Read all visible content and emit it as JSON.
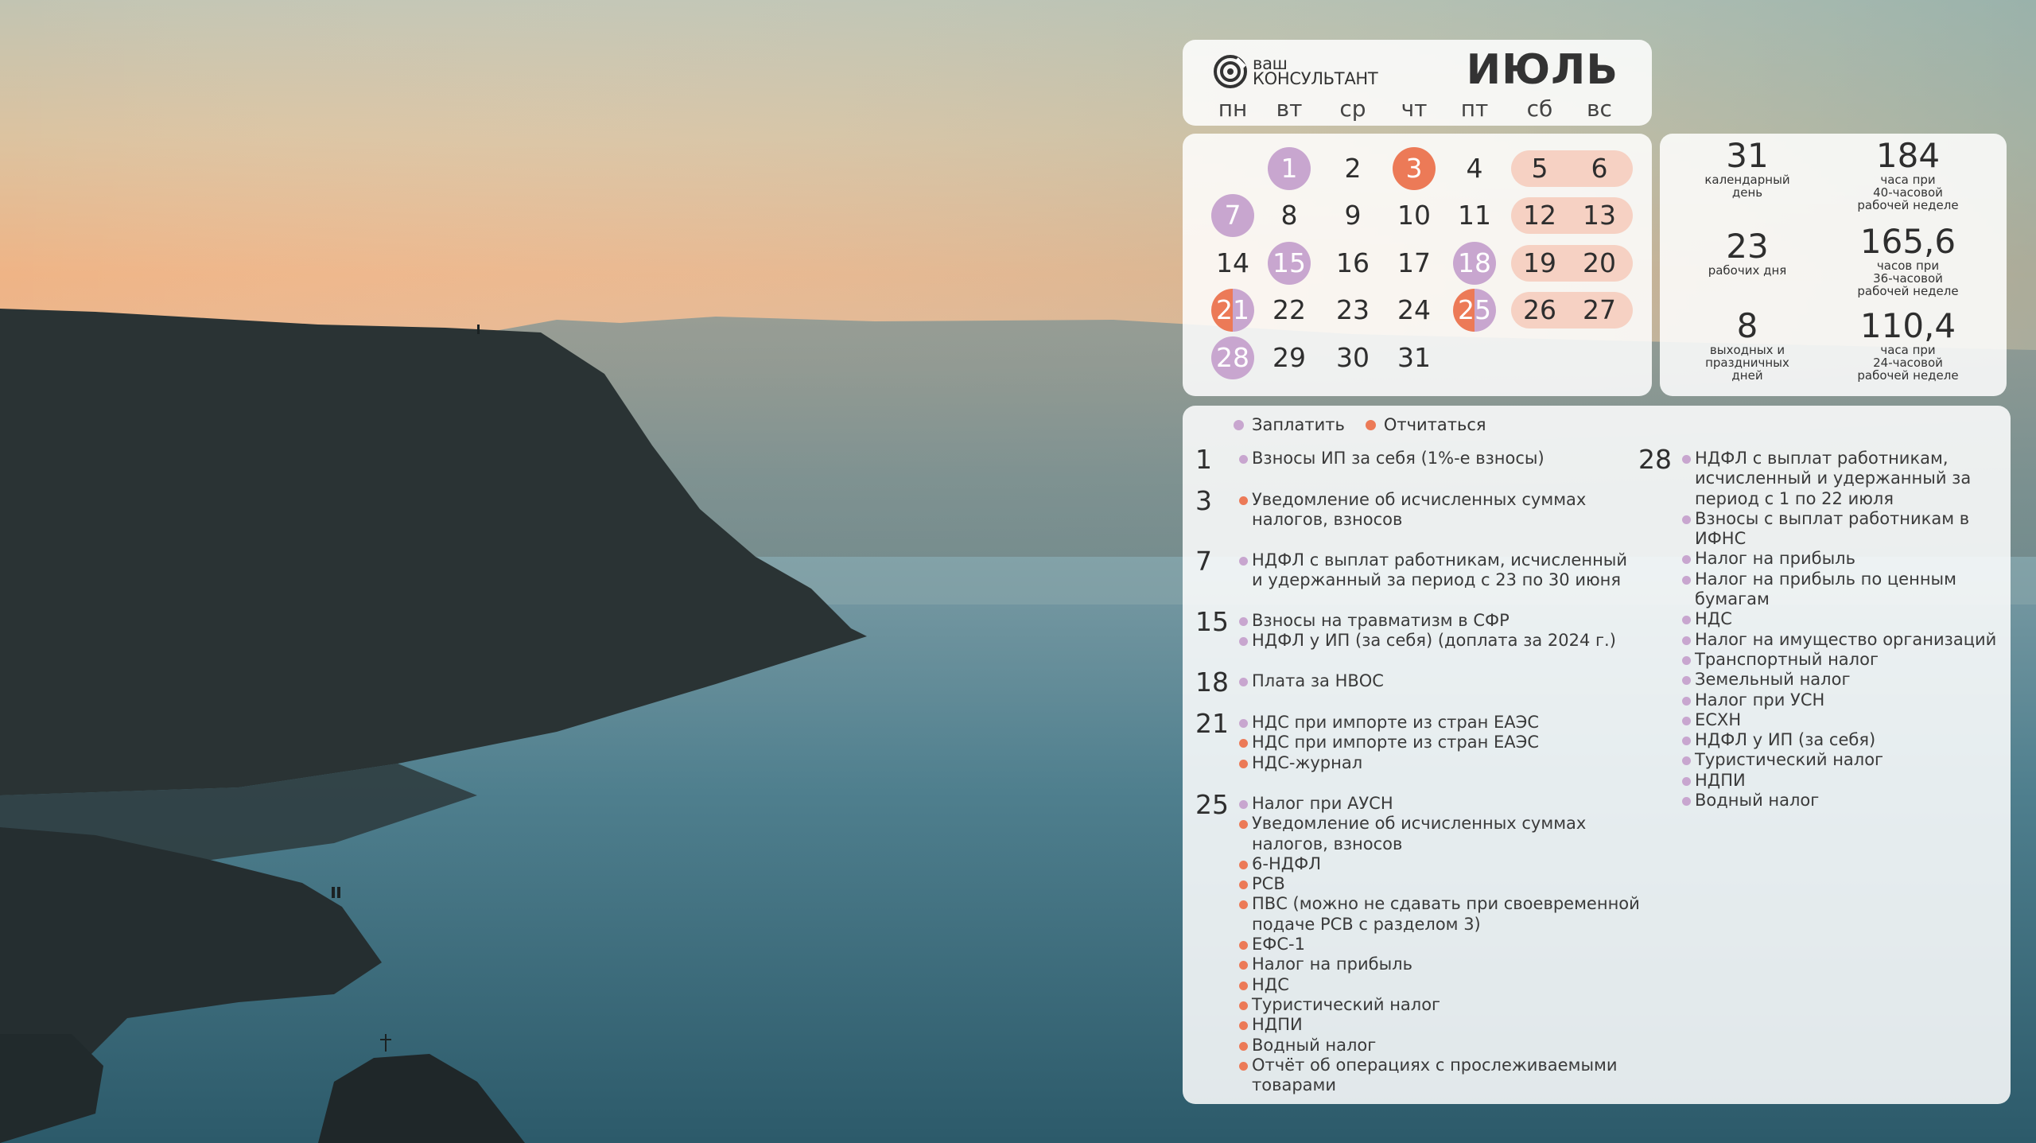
{
  "colors": {
    "pay": "#c8a6cf",
    "report": "#ec7a57",
    "weekend": "#f6d1c3"
  },
  "header": {
    "logo": {
      "line1": "ваш",
      "line2": "КОНСУЛЬТАНТ",
      "icon": "consultant-logo-icon"
    },
    "month": "ИЮЛЬ",
    "weekdays": [
      "пн",
      "вт",
      "ср",
      "чт",
      "пт",
      "сб",
      "вс"
    ]
  },
  "calendar": {
    "weeks": [
      [
        null,
        {
          "d": "1",
          "mark": "pay"
        },
        {
          "d": "2"
        },
        {
          "d": "3",
          "mark": "report"
        },
        {
          "d": "4"
        },
        {
          "d": "5",
          "weekend": true
        },
        {
          "d": "6",
          "weekend": true
        }
      ],
      [
        {
          "d": "7",
          "mark": "pay"
        },
        {
          "d": "8"
        },
        {
          "d": "9"
        },
        {
          "d": "10"
        },
        {
          "d": "11"
        },
        {
          "d": "12",
          "weekend": true
        },
        {
          "d": "13",
          "weekend": true
        }
      ],
      [
        {
          "d": "14"
        },
        {
          "d": "15",
          "mark": "pay"
        },
        {
          "d": "16"
        },
        {
          "d": "17"
        },
        {
          "d": "18",
          "mark": "pay"
        },
        {
          "d": "19",
          "weekend": true
        },
        {
          "d": "20",
          "weekend": true
        }
      ],
      [
        {
          "d": "21",
          "mark": "both"
        },
        {
          "d": "22"
        },
        {
          "d": "23"
        },
        {
          "d": "24"
        },
        {
          "d": "25",
          "mark": "both"
        },
        {
          "d": "26",
          "weekend": true
        },
        {
          "d": "27",
          "weekend": true
        }
      ],
      [
        {
          "d": "28",
          "mark": "pay"
        },
        {
          "d": "29"
        },
        {
          "d": "30"
        },
        {
          "d": "31"
        },
        null,
        null,
        null
      ]
    ]
  },
  "stats": [
    {
      "value": "31",
      "label": [
        "календарный",
        "день"
      ]
    },
    {
      "value": "184",
      "label": [
        "часа при",
        "40-часовой",
        "рабочей неделе"
      ]
    },
    {
      "value": "23",
      "label": [
        "рабочих дня"
      ]
    },
    {
      "value": "165,6",
      "label": [
        "часов при",
        "36-часовой",
        "рабочей неделе"
      ]
    },
    {
      "value": "8",
      "label": [
        "выходных и",
        "праздничных",
        "дней"
      ]
    },
    {
      "value": "110,4",
      "label": [
        "часа при",
        "24-часовой",
        "рабочей неделе"
      ]
    }
  ],
  "legend": {
    "pay": "Заплатить",
    "report": "Отчитаться"
  },
  "deadlines_left": [
    {
      "day": "1",
      "items": [
        {
          "type": "pay",
          "text": "Взносы ИП за себя (1%-е взносы)"
        }
      ]
    },
    {
      "day": "3",
      "items": [
        {
          "type": "report",
          "text": "Уведомление об исчисленных суммах налогов, взносов"
        }
      ]
    },
    {
      "day": "7",
      "items": [
        {
          "type": "pay",
          "text": "НДФЛ с выплат работникам, исчисленный и удержанный за период с 23 по 30 июня"
        }
      ]
    },
    {
      "day": "15",
      "items": [
        {
          "type": "pay",
          "text": "Взносы на травматизм в СФР"
        },
        {
          "type": "pay",
          "text": "НДФЛ у ИП (за себя) (доплата за 2024 г.)"
        }
      ]
    },
    {
      "day": "18",
      "items": [
        {
          "type": "pay",
          "text": "Плата за НВОС"
        }
      ]
    },
    {
      "day": "21",
      "items": [
        {
          "type": "pay",
          "text": "НДС при импорте из стран ЕАЭС"
        },
        {
          "type": "report",
          "text": "НДС при импорте из стран ЕАЭС"
        },
        {
          "type": "report",
          "text": "НДС-журнал"
        }
      ]
    },
    {
      "day": "25",
      "items": [
        {
          "type": "pay",
          "text": "Налог при АУСН"
        },
        {
          "type": "report",
          "text": "Уведомление об исчисленных суммах налогов, взносов"
        },
        {
          "type": "report",
          "text": "6-НДФЛ"
        },
        {
          "type": "report",
          "text": "РСВ"
        },
        {
          "type": "report",
          "text": "ПВС (можно не сдавать при своевременной подаче РСВ с разделом 3)"
        },
        {
          "type": "report",
          "text": "ЕФС-1"
        },
        {
          "type": "report",
          "text": "Налог на прибыль"
        },
        {
          "type": "report",
          "text": "НДС"
        },
        {
          "type": "report",
          "text": "Туристический налог"
        },
        {
          "type": "report",
          "text": "НДПИ"
        },
        {
          "type": "report",
          "text": "Водный налог"
        },
        {
          "type": "report",
          "text": "Отчёт об операциях с прослеживаемыми товарами"
        }
      ]
    }
  ],
  "deadlines_right": [
    {
      "day": "28",
      "items": [
        {
          "type": "pay",
          "text": "НДФЛ с выплат работникам, исчисленный и удержанный за период с 1 по 22 июля"
        },
        {
          "type": "pay",
          "text": "Взносы с выплат работникам в ИФНС"
        },
        {
          "type": "pay",
          "text": "Налог на прибыль"
        },
        {
          "type": "pay",
          "text": "Налог на прибыль по ценным бумагам"
        },
        {
          "type": "pay",
          "text": "НДС"
        },
        {
          "type": "pay",
          "text": "Налог на имущество организаций"
        },
        {
          "type": "pay",
          "text": "Транспортный налог"
        },
        {
          "type": "pay",
          "text": "Земельный налог"
        },
        {
          "type": "pay",
          "text": "Налог при УСН"
        },
        {
          "type": "pay",
          "text": "ЕСХН"
        },
        {
          "type": "pay",
          "text": "НДФЛ у ИП (за себя)"
        },
        {
          "type": "pay",
          "text": "Туристический налог"
        },
        {
          "type": "pay",
          "text": "НДПИ"
        },
        {
          "type": "pay",
          "text": "Водный налог"
        }
      ]
    }
  ]
}
